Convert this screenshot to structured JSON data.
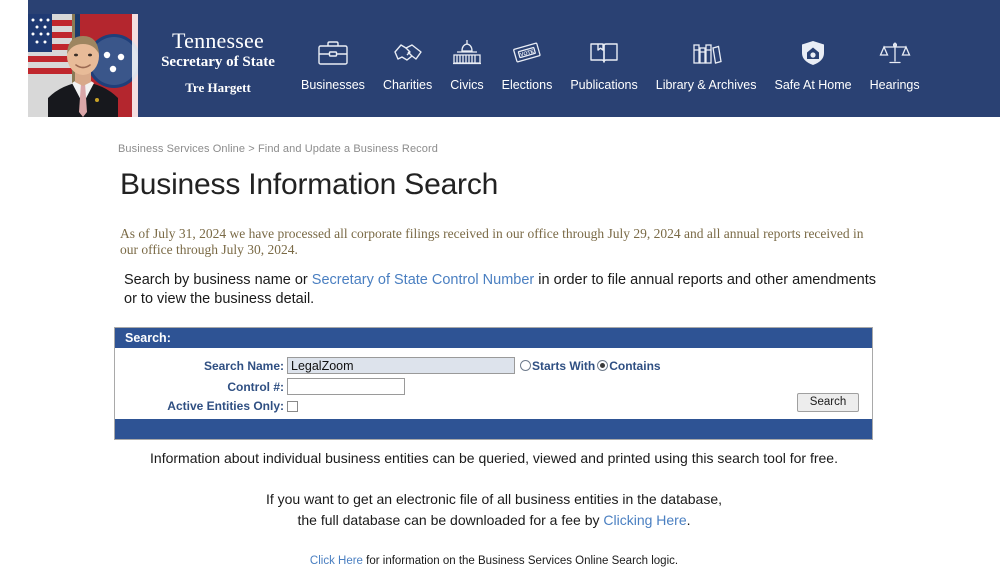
{
  "header": {
    "brand": {
      "line1": "Tennessee",
      "line2": "Secretary of State",
      "line3": "Tre Hargett"
    },
    "nav": [
      {
        "label": "Businesses",
        "icon": "briefcase-icon"
      },
      {
        "label": "Charities",
        "icon": "handshake-icon"
      },
      {
        "label": "Civics",
        "icon": "capitol-icon"
      },
      {
        "label": "Elections",
        "icon": "vote-ballot-icon"
      },
      {
        "label": "Publications",
        "icon": "open-book-icon"
      },
      {
        "label": "Library & Archives",
        "icon": "books-icon"
      },
      {
        "label": "Safe At Home",
        "icon": "shield-home-icon"
      },
      {
        "label": "Hearings",
        "icon": "scales-icon"
      }
    ],
    "colors": {
      "bar": "#2a4173",
      "text": "#ffffff"
    }
  },
  "breadcrumb": "Business Services Online > Find and Update a Business Record",
  "page_title": "Business Information Search",
  "notice": "As of July 31, 2024 we have processed all corporate filings received in our office through July 29, 2024 and all annual reports received in our office through July 30, 2024.",
  "lead": {
    "before_link": "Search by business name or ",
    "link": "Secretary of State Control Number",
    "after_link": " in order to file annual reports and other amendments or to view the business detail."
  },
  "search_panel": {
    "header_label": "Search:",
    "fields": {
      "search_name_label": "Search Name:",
      "search_name_value": "LegalZoom",
      "search_name_placeholder": "",
      "control_number_label": "Control #:",
      "control_number_value": "",
      "control_number_placeholder": "",
      "active_entities_label": "Active Entities Only:",
      "active_entities_checked": false
    },
    "match_mode": {
      "options": [
        "Starts With",
        "Contains"
      ],
      "selected": "Contains"
    },
    "submit_label": "Search",
    "colors": {
      "bar": "#2e5394",
      "label": "#2f4f82",
      "focused_input_bg": "#dde3ec"
    }
  },
  "footer": {
    "line1": "Information about individual business entities can be queried, viewed and printed using this search tool for free.",
    "block2_line1": "If you want to get an electronic file of all business entities in the database,",
    "block2_line2_before": "the full database can be downloaded for a fee by ",
    "block2_link": "Clicking Here",
    "block2_line2_after": ".",
    "block3_link": "Click Here",
    "block3_after": " for information on the Business Services Online Search logic."
  }
}
